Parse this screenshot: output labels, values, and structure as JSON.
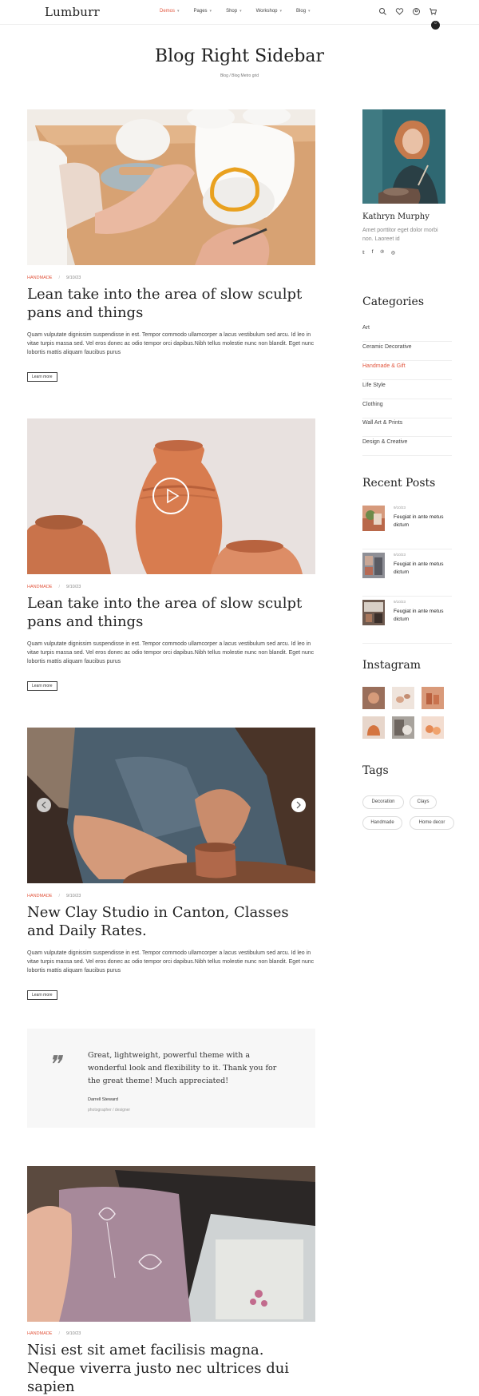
{
  "header": {
    "logo": "Lumburr",
    "nav": [
      "Demos",
      "Pages",
      "Shop",
      "Workshop",
      "Blog"
    ],
    "cart_count": "0"
  },
  "page": {
    "title": "Blog Right Sidebar",
    "breadcrumb_home": "Blog",
    "breadcrumb_sep": "/",
    "breadcrumb_current": "Blog Metro grid"
  },
  "posts": [
    {
      "category": "HANDMADE",
      "date": "9/10/23",
      "title": "Lean take into the area of slow sculpt pans and things",
      "excerpt": "Quam vulputate dignissim suspendisse in est. Tempor commodo ullamcorper a lacus vestibulum sed arcu. Id leo in vitae turpis massa sed. Vel eros donec ac odio tempor orci dapibus.Nibh tellus molestie nunc non blandit. Eget nunc lobortis mattis aliquam faucibus purus",
      "more": "Learn more"
    },
    {
      "category": "HANDMADE",
      "date": "9/10/23",
      "title": "Lean take into the area of slow sculpt pans and things",
      "excerpt": "Quam vulputate dignissim suspendisse in est. Tempor commodo ullamcorper a lacus vestibulum sed arcu. Id leo in vitae turpis massa sed. Vel eros donec ac odio tempor orci dapibus.Nibh tellus molestie nunc non blandit. Eget nunc lobortis mattis aliquam faucibus purus",
      "more": "Learn more"
    },
    {
      "category": "HANDMADE",
      "date": "9/10/23",
      "title": "New Clay Studio in Canton, Classes and Daily Rates.",
      "excerpt": "Quam vulputate dignissim suspendisse in est. Tempor commodo ullamcorper a lacus vestibulum sed arcu. Id leo in vitae turpis massa sed. Vel eros donec ac odio tempor orci dapibus.Nibh tellus molestie nunc non blandit. Eget nunc lobortis mattis aliquam faucibus purus",
      "more": "Learn more"
    },
    {
      "category": "HANDMADE",
      "date": "9/10/23",
      "title": "Nisi est sit amet facilisis magna. Neque viverra justo nec ultrices dui sapien"
    }
  ],
  "quote": {
    "text": "Great, lightweight, powerful theme with a wonderful look and flexibility to it. Thank you for the great theme! Much appreciated!",
    "name": "Darrell Steward",
    "role": "photographer / designer"
  },
  "sidebar": {
    "author_name": "Kathryn Murphy",
    "author_bio": "Amet porttitor eget dolor morbi non. Laoreet id",
    "categories_title": "Categories",
    "categories": [
      "Art",
      "Ceramic Decorative",
      "Handmade & Gift",
      "Life Style",
      "Clothing",
      "Wall Art & Prints",
      "Design & Creative"
    ],
    "active_category": "Handmade & Gift",
    "recent_title": "Recent Posts",
    "recent": [
      {
        "date": "9/10/23",
        "title": "Feugiat in ante metus dictum"
      },
      {
        "date": "9/10/23",
        "title": "Feugiat in ante metus dictum"
      },
      {
        "date": "9/10/23",
        "title": "Feugiat in ante metus dictum"
      }
    ],
    "instagram_title": "Instagram",
    "tags_title": "Tags",
    "tags": [
      "Decoration",
      "Clays",
      "Handmade",
      "Home decor"
    ]
  },
  "colors": {
    "accent": "#e2573f",
    "text": "#222222",
    "muted": "#888888"
  }
}
